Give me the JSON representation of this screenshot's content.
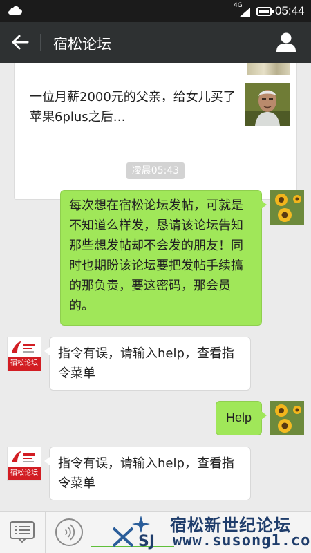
{
  "status_bar": {
    "network": "4G",
    "time": "05:44",
    "weather_icon": "cloud-icon"
  },
  "title_bar": {
    "back_icon": "back-arrow-icon",
    "title": "宿松论坛",
    "profile_icon": "user-icon"
  },
  "chat": {
    "article_card": {
      "text": "一位月薪2000元的父亲，给女儿买了苹果6plus之后…"
    },
    "timestamp": "凌晨05:43",
    "messages": [
      {
        "side": "right",
        "text": "每次想在宿松论坛发帖，可就是不知道么样发，恳请该论坛告知那些想发帖却不会发的朋友！同时也期盼该论坛要把发帖手续搞的那负责，要这密码，那会员的。"
      },
      {
        "side": "left",
        "text": "指令有误，请输入help，查看指令菜单"
      },
      {
        "side": "right",
        "text": "Help"
      },
      {
        "side": "left",
        "text": "指令有误，请输入help，查看指令菜单"
      }
    ],
    "bot_avatar_label": "宿松论坛"
  },
  "bottom_bar": {
    "menu_icon": "list-menu-icon",
    "voice_icon": "voice-icon"
  },
  "watermark": {
    "name": "宿松新世纪论坛",
    "url": "www.susong1.com"
  },
  "colors": {
    "sent_bubble": "#a0e759",
    "title_bar": "#2e3132",
    "brand_red": "#d21d23",
    "watermark": "#1f3d6b"
  }
}
